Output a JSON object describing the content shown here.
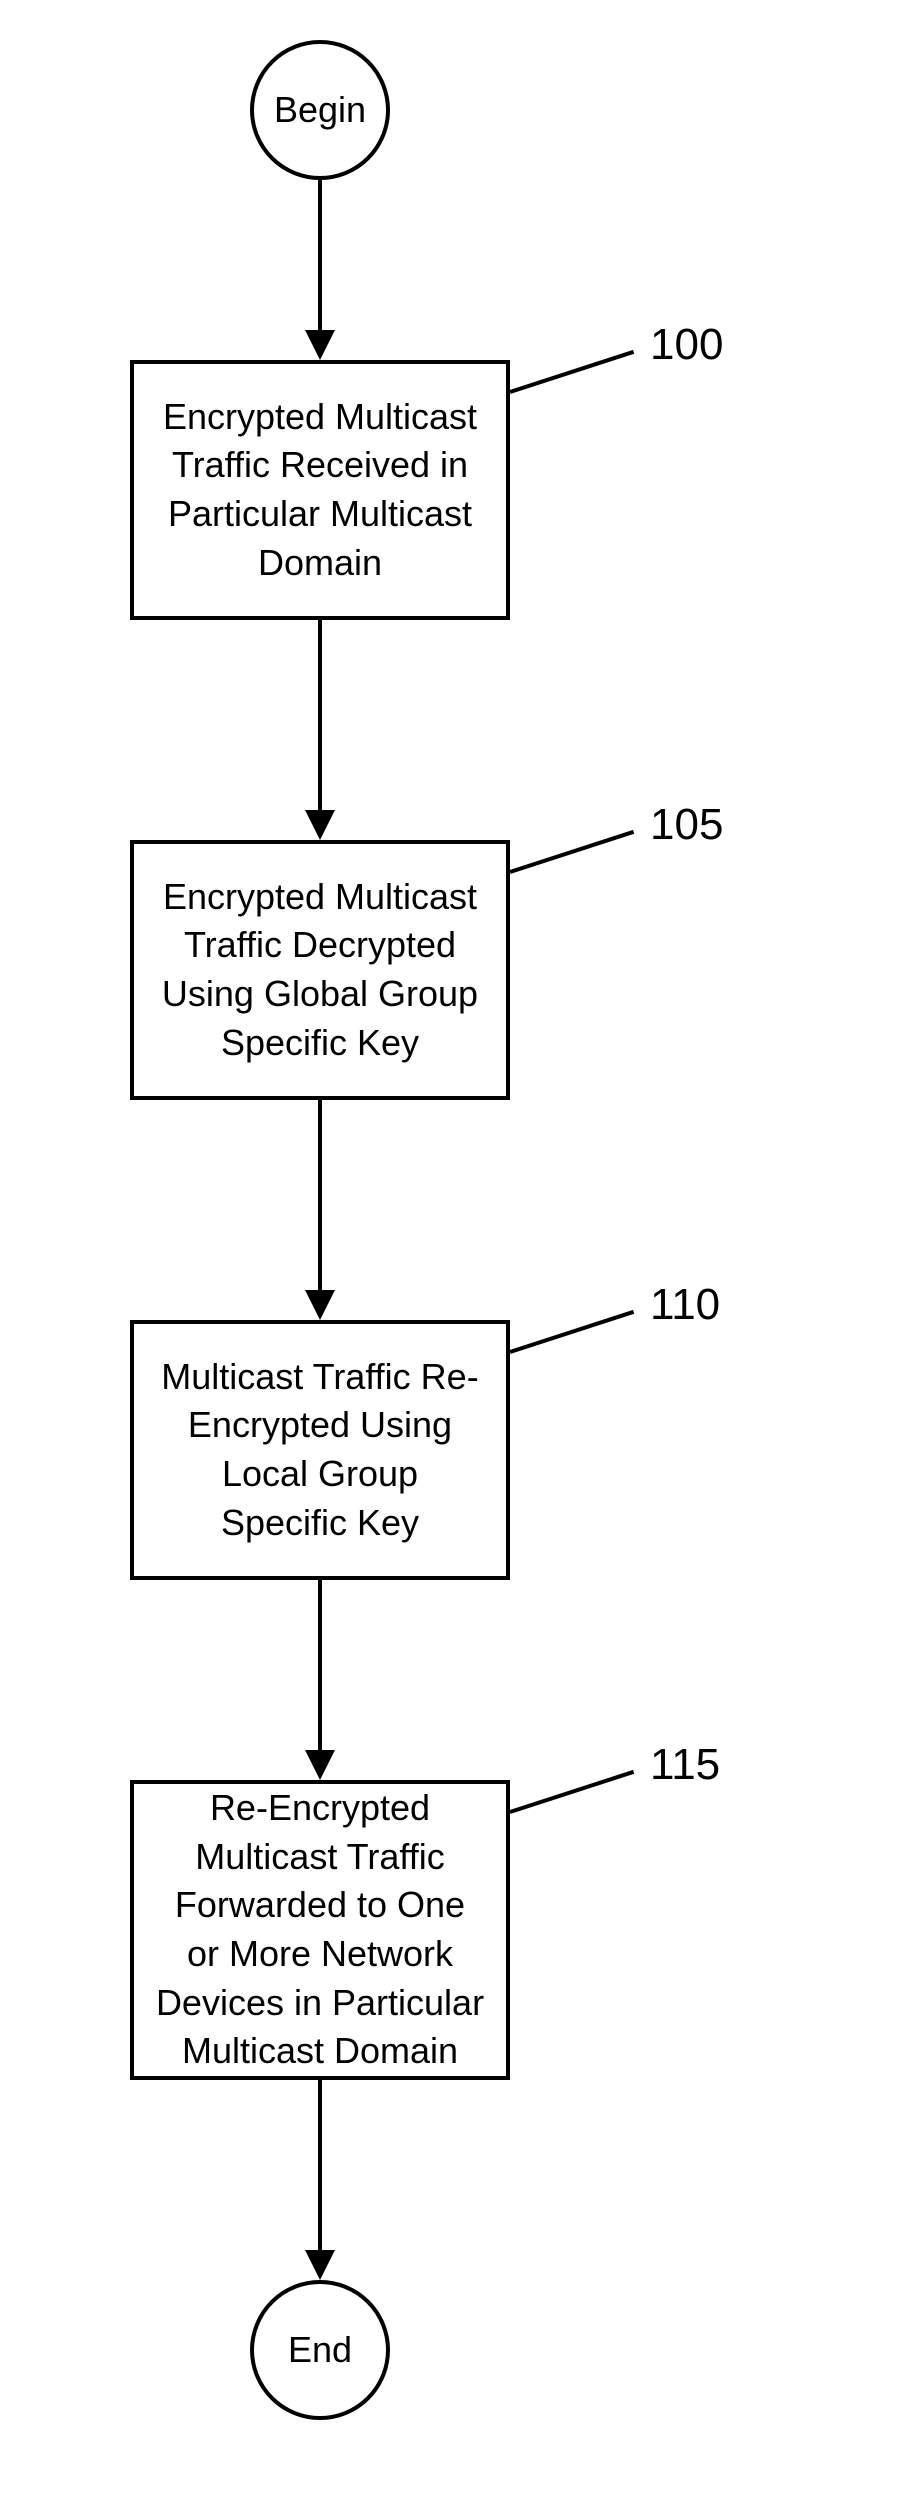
{
  "chart_data": {
    "type": "flowchart",
    "title": "",
    "nodes": [
      {
        "id": "begin",
        "kind": "terminal",
        "text": "Begin"
      },
      {
        "id": "s100",
        "kind": "process",
        "text": "Encrypted Multicast Traffic Received in Particular Multicast Domain",
        "ref": "100"
      },
      {
        "id": "s105",
        "kind": "process",
        "text": "Encrypted Multicast Traffic Decrypted Using Global Group Specific Key",
        "ref": "105"
      },
      {
        "id": "s110",
        "kind": "process",
        "text": "Multicast Traffic Re-Encrypted Using Local Group Specific Key",
        "ref": "110"
      },
      {
        "id": "s115",
        "kind": "process",
        "text": "Re-Encrypted Multicast Traffic Forwarded to One or More Network Devices in Particular Multicast Domain",
        "ref": "115"
      },
      {
        "id": "end",
        "kind": "terminal",
        "text": "End"
      }
    ],
    "edges": [
      [
        "begin",
        "s100"
      ],
      [
        "s100",
        "s105"
      ],
      [
        "s105",
        "s110"
      ],
      [
        "s110",
        "s115"
      ],
      [
        "s115",
        "end"
      ]
    ]
  },
  "terminals": {
    "begin": "Begin",
    "end": "End"
  },
  "steps": {
    "s100": {
      "text": "Encrypted Multicast Traffic Received in Particular Multicast Domain",
      "ref": "100"
    },
    "s105": {
      "text": "Encrypted Multicast Traffic Decrypted Using Global Group Specific Key",
      "ref": "105"
    },
    "s110": {
      "text": "Multicast Traffic Re-Encrypted Using Local Group Specific Key",
      "ref": "110"
    },
    "s115": {
      "text": "Re-Encrypted Multicast Traffic Forwarded to One or More Network Devices in Particular Multicast Domain",
      "ref": "115"
    }
  }
}
